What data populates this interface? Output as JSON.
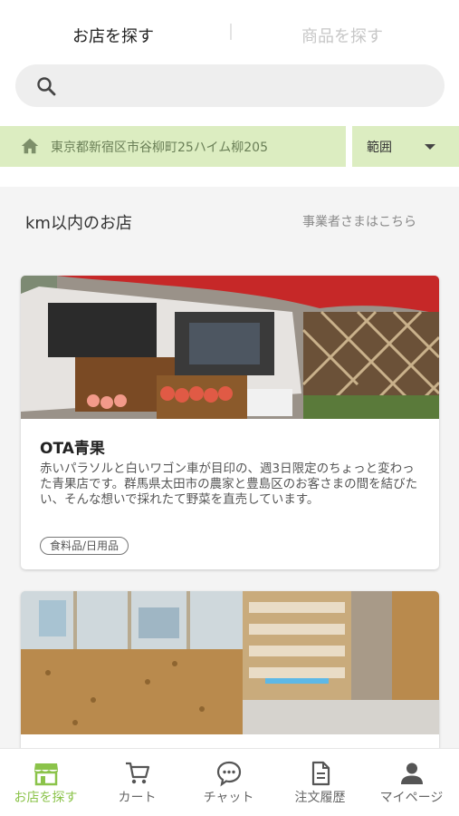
{
  "tabs": {
    "store": "お店を探す",
    "product": "商品を探す"
  },
  "search": {
    "value": "",
    "placeholder": "",
    "icon": "search-icon"
  },
  "location": {
    "address": "東京都新宿区市谷柳町25ハイム柳205",
    "icon": "home-icon",
    "range_label": "範囲"
  },
  "section": {
    "title": "km以内のお店",
    "business_link": "事業者さまはこちら"
  },
  "stores": [
    {
      "name": "OTA青果",
      "description": "赤いパラソルと白いワゴン車が目印の、週3日限定のちょっと変わった青果店です。群馬県太田市の農家と豊島区のお客さまの間を結びたい、そんな想いで採れたて野菜を直売しています。",
      "tag": "食料品/日用品"
    },
    {
      "name": "",
      "description": "",
      "tag": ""
    }
  ],
  "bottom_nav": [
    {
      "label": "お店を探す",
      "icon": "store-icon",
      "active": true
    },
    {
      "label": "カート",
      "icon": "cart-icon",
      "active": false
    },
    {
      "label": "チャット",
      "icon": "chat-icon",
      "active": false
    },
    {
      "label": "注文履歴",
      "icon": "document-icon",
      "active": false
    },
    {
      "label": "マイページ",
      "icon": "person-icon",
      "active": false
    }
  ],
  "colors": {
    "accent": "#8bc34a",
    "address_bar": "#dcedc1",
    "umbrella_red": "#c62828"
  }
}
